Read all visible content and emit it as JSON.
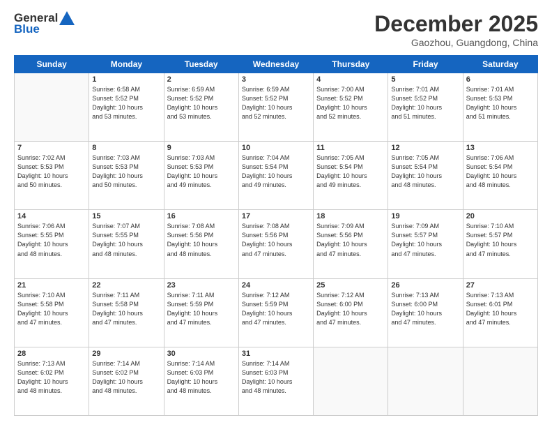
{
  "header": {
    "logo_line1": "General",
    "logo_line2": "Blue",
    "month": "December 2025",
    "location": "Gaozhou, Guangdong, China"
  },
  "weekdays": [
    "Sunday",
    "Monday",
    "Tuesday",
    "Wednesday",
    "Thursday",
    "Friday",
    "Saturday"
  ],
  "weeks": [
    [
      {
        "day": "",
        "info": ""
      },
      {
        "day": "1",
        "info": "Sunrise: 6:58 AM\nSunset: 5:52 PM\nDaylight: 10 hours\nand 53 minutes."
      },
      {
        "day": "2",
        "info": "Sunrise: 6:59 AM\nSunset: 5:52 PM\nDaylight: 10 hours\nand 53 minutes."
      },
      {
        "day": "3",
        "info": "Sunrise: 6:59 AM\nSunset: 5:52 PM\nDaylight: 10 hours\nand 52 minutes."
      },
      {
        "day": "4",
        "info": "Sunrise: 7:00 AM\nSunset: 5:52 PM\nDaylight: 10 hours\nand 52 minutes."
      },
      {
        "day": "5",
        "info": "Sunrise: 7:01 AM\nSunset: 5:52 PM\nDaylight: 10 hours\nand 51 minutes."
      },
      {
        "day": "6",
        "info": "Sunrise: 7:01 AM\nSunset: 5:53 PM\nDaylight: 10 hours\nand 51 minutes."
      }
    ],
    [
      {
        "day": "7",
        "info": "Sunrise: 7:02 AM\nSunset: 5:53 PM\nDaylight: 10 hours\nand 50 minutes."
      },
      {
        "day": "8",
        "info": "Sunrise: 7:03 AM\nSunset: 5:53 PM\nDaylight: 10 hours\nand 50 minutes."
      },
      {
        "day": "9",
        "info": "Sunrise: 7:03 AM\nSunset: 5:53 PM\nDaylight: 10 hours\nand 49 minutes."
      },
      {
        "day": "10",
        "info": "Sunrise: 7:04 AM\nSunset: 5:54 PM\nDaylight: 10 hours\nand 49 minutes."
      },
      {
        "day": "11",
        "info": "Sunrise: 7:05 AM\nSunset: 5:54 PM\nDaylight: 10 hours\nand 49 minutes."
      },
      {
        "day": "12",
        "info": "Sunrise: 7:05 AM\nSunset: 5:54 PM\nDaylight: 10 hours\nand 48 minutes."
      },
      {
        "day": "13",
        "info": "Sunrise: 7:06 AM\nSunset: 5:54 PM\nDaylight: 10 hours\nand 48 minutes."
      }
    ],
    [
      {
        "day": "14",
        "info": "Sunrise: 7:06 AM\nSunset: 5:55 PM\nDaylight: 10 hours\nand 48 minutes."
      },
      {
        "day": "15",
        "info": "Sunrise: 7:07 AM\nSunset: 5:55 PM\nDaylight: 10 hours\nand 48 minutes."
      },
      {
        "day": "16",
        "info": "Sunrise: 7:08 AM\nSunset: 5:56 PM\nDaylight: 10 hours\nand 48 minutes."
      },
      {
        "day": "17",
        "info": "Sunrise: 7:08 AM\nSunset: 5:56 PM\nDaylight: 10 hours\nand 47 minutes."
      },
      {
        "day": "18",
        "info": "Sunrise: 7:09 AM\nSunset: 5:56 PM\nDaylight: 10 hours\nand 47 minutes."
      },
      {
        "day": "19",
        "info": "Sunrise: 7:09 AM\nSunset: 5:57 PM\nDaylight: 10 hours\nand 47 minutes."
      },
      {
        "day": "20",
        "info": "Sunrise: 7:10 AM\nSunset: 5:57 PM\nDaylight: 10 hours\nand 47 minutes."
      }
    ],
    [
      {
        "day": "21",
        "info": "Sunrise: 7:10 AM\nSunset: 5:58 PM\nDaylight: 10 hours\nand 47 minutes."
      },
      {
        "day": "22",
        "info": "Sunrise: 7:11 AM\nSunset: 5:58 PM\nDaylight: 10 hours\nand 47 minutes."
      },
      {
        "day": "23",
        "info": "Sunrise: 7:11 AM\nSunset: 5:59 PM\nDaylight: 10 hours\nand 47 minutes."
      },
      {
        "day": "24",
        "info": "Sunrise: 7:12 AM\nSunset: 5:59 PM\nDaylight: 10 hours\nand 47 minutes."
      },
      {
        "day": "25",
        "info": "Sunrise: 7:12 AM\nSunset: 6:00 PM\nDaylight: 10 hours\nand 47 minutes."
      },
      {
        "day": "26",
        "info": "Sunrise: 7:13 AM\nSunset: 6:00 PM\nDaylight: 10 hours\nand 47 minutes."
      },
      {
        "day": "27",
        "info": "Sunrise: 7:13 AM\nSunset: 6:01 PM\nDaylight: 10 hours\nand 47 minutes."
      }
    ],
    [
      {
        "day": "28",
        "info": "Sunrise: 7:13 AM\nSunset: 6:02 PM\nDaylight: 10 hours\nand 48 minutes."
      },
      {
        "day": "29",
        "info": "Sunrise: 7:14 AM\nSunset: 6:02 PM\nDaylight: 10 hours\nand 48 minutes."
      },
      {
        "day": "30",
        "info": "Sunrise: 7:14 AM\nSunset: 6:03 PM\nDaylight: 10 hours\nand 48 minutes."
      },
      {
        "day": "31",
        "info": "Sunrise: 7:14 AM\nSunset: 6:03 PM\nDaylight: 10 hours\nand 48 minutes."
      },
      {
        "day": "",
        "info": ""
      },
      {
        "day": "",
        "info": ""
      },
      {
        "day": "",
        "info": ""
      }
    ]
  ]
}
